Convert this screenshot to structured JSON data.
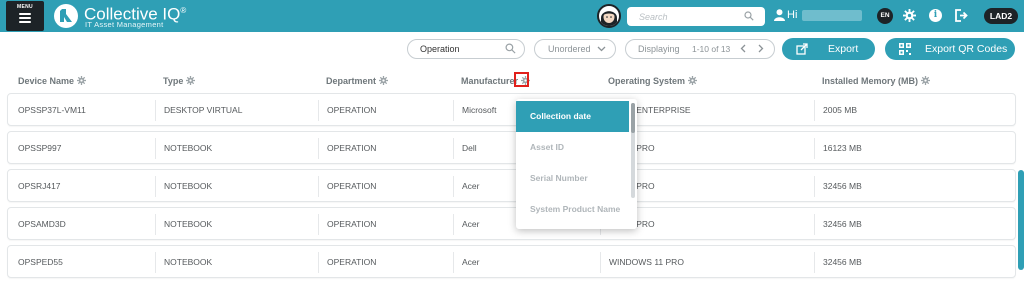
{
  "header": {
    "menu_label": "MENU",
    "brand_name": "Collective IQ",
    "brand_mark": "®",
    "brand_subtitle": "IT Asset Management",
    "search_placeholder": "Search",
    "greeting": "Hi",
    "language": "EN",
    "tenant": "LAD2",
    "colors": {
      "primary": "#2f9fb5",
      "dark": "#1d2327"
    }
  },
  "toolbar": {
    "filter_value": "Operation",
    "order_value": "Unordered",
    "displaying_label": "Displaying",
    "range_text": "1-10 of 13",
    "export_label": "Export",
    "export_qr_label": "Export QR Codes"
  },
  "table": {
    "columns": [
      "Device Name",
      "Type",
      "Department",
      "Manufacturer",
      "Operating System",
      "Installed Memory (MB)"
    ],
    "rows": [
      [
        "OPSSP37L-VM11",
        "DESKTOP VIRTUAL",
        "OPERATION",
        "Microsoft",
        "WS 11 ENTERPRISE",
        "2005 MB"
      ],
      [
        "OPSSP997",
        "NOTEBOOK",
        "OPERATION",
        "Dell",
        "WS 11 PRO",
        "16123 MB"
      ],
      [
        "OPSRJ417",
        "NOTEBOOK",
        "OPERATION",
        "Acer",
        "WS 11 PRO",
        "32456 MB"
      ],
      [
        "OPSAMD3D",
        "NOTEBOOK",
        "OPERATION",
        "Acer",
        "WS 11 PRO",
        "32456 MB"
      ],
      [
        "OPSPED55",
        "NOTEBOOK",
        "OPERATION",
        "Acer",
        "WINDOWS 11 PRO",
        "32456 MB"
      ]
    ]
  },
  "column_menu": {
    "items": [
      "Collection date",
      "Asset ID",
      "Serial Number",
      "System Product Name"
    ],
    "active_index": 0
  }
}
